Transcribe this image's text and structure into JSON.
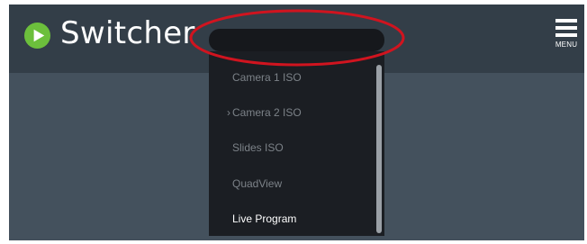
{
  "brand": {
    "name": "Switcher",
    "logo_icon": "play-circle-icon",
    "logo_color": "#6cbf3c"
  },
  "header": {
    "source_select_value": "",
    "menu_label": "MENU",
    "menu_icon": "hamburger-icon"
  },
  "dropdown": {
    "items": [
      {
        "label": "Camera 1 ISO",
        "state": "dim"
      },
      {
        "label": "Camera 2 ISO",
        "state": "dim",
        "marker": "›"
      },
      {
        "label": "Slides ISO",
        "state": "dim"
      },
      {
        "label": "QuadView",
        "state": "dim"
      },
      {
        "label": "Live Program",
        "state": "active"
      }
    ]
  },
  "annotation": {
    "shape": "ellipse",
    "color": "#d0141f"
  },
  "colors": {
    "header_bg": "#333e48",
    "body_bg": "#44515d",
    "dropdown_bg": "#1b1e23"
  }
}
